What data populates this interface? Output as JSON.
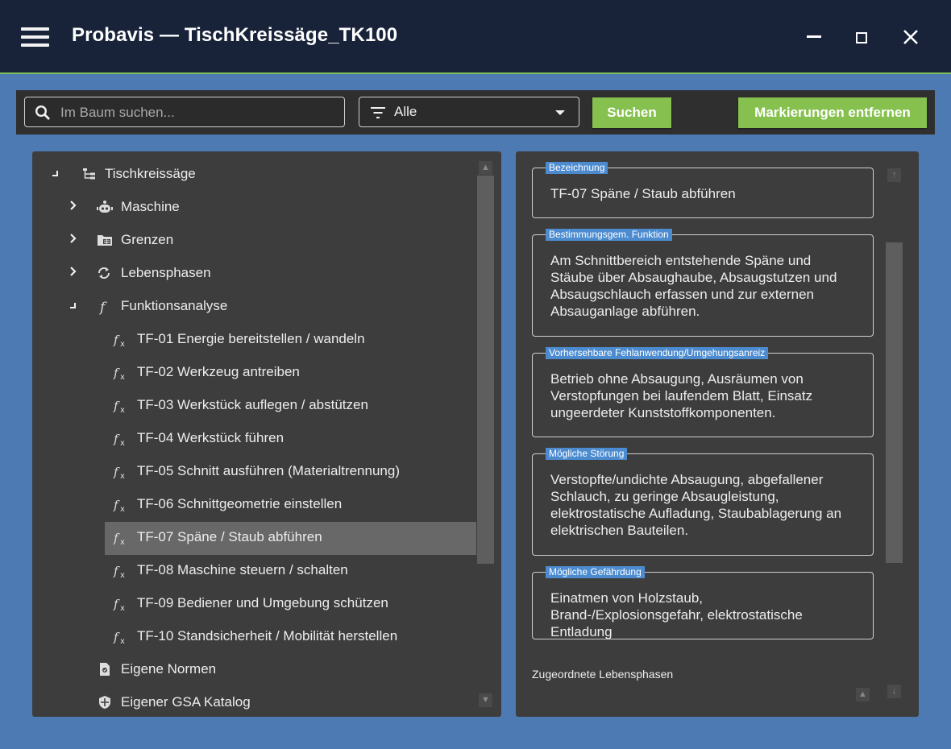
{
  "window": {
    "title": "Probavis — TischKreissäge_TK100"
  },
  "toolbar": {
    "search_placeholder": "Im Baum suchen...",
    "filter_value": "Alle",
    "search_button": "Suchen",
    "clear_button": "Markierungen entfernen"
  },
  "tree": {
    "root": "Tischkreissäge",
    "items": [
      {
        "label": "Maschine",
        "icon": "robot-icon"
      },
      {
        "label": "Grenzen",
        "icon": "folder-icon"
      },
      {
        "label": "Lebensphasen",
        "icon": "cycle-icon"
      },
      {
        "label": "Funktionsanalyse",
        "icon": "function-icon"
      },
      {
        "label": "TF-01 Energie bereitstellen / wandeln",
        "icon": "fx-icon"
      },
      {
        "label": "TF-02 Werkzeug antreiben",
        "icon": "fx-icon"
      },
      {
        "label": "TF-03 Werkstück auflegen / abstützen",
        "icon": "fx-icon"
      },
      {
        "label": "TF-04 Werkstück führen",
        "icon": "fx-icon"
      },
      {
        "label": "TF-05 Schnitt ausführen (Materialtrennung)",
        "icon": "fx-icon"
      },
      {
        "label": "TF-06 Schnittgeometrie einstellen",
        "icon": "fx-icon"
      },
      {
        "label": "TF-07 Späne / Staub abführen",
        "icon": "fx-icon"
      },
      {
        "label": "TF-08 Maschine steuern / schalten",
        "icon": "fx-icon"
      },
      {
        "label": "TF-09 Bediener und Umgebung schützen",
        "icon": "fx-icon"
      },
      {
        "label": "TF-10 Standsicherheit / Mobilität herstellen",
        "icon": "fx-icon"
      },
      {
        "label": "Eigene Normen",
        "icon": "norm-document-icon"
      },
      {
        "label": "Eigener GSA Katalog",
        "icon": "shield-icon"
      }
    ]
  },
  "detail": {
    "fields": [
      {
        "label": "Bezeichnung",
        "value": "TF-07 Späne / Staub abführen"
      },
      {
        "label": "Bestimmungsgem. Funktion",
        "value": "Am Schnittbereich entstehende Späne und Stäube über Absaughaube, Absaugstutzen und Absaugschlauch erfassen und zur externen Absauganlage abführen."
      },
      {
        "label": "Vorhersehbare Fehlanwendung/Umgehungsanreiz",
        "value": "Betrieb ohne Absaugung, Ausräumen von Verstopfungen bei laufendem Blatt, Einsatz ungeerdeter Kunststoffkomponenten."
      },
      {
        "label": "Mögliche Störung",
        "value": "Verstopfte/undichte Absaugung, abgefallener Schlauch, zu geringe Absaugleistung, elektrostatische Aufladung, Staubablagerung an elektrischen Bauteilen."
      },
      {
        "label": "Mögliche Gefährdung",
        "value": "Einatmen von Holzstaub, Brand-/Explosionsgefahr, elektrostatische Entladung"
      }
    ],
    "assigned_phases_label": "Zugeordnete Lebensphasen"
  },
  "colors": {
    "background": "#4d7ab3",
    "titlebar": "#18233a",
    "accent_green": "#86c14f",
    "panel": "#3d3d3d",
    "selection": "#686868",
    "field_label": "#4c8bd0"
  }
}
